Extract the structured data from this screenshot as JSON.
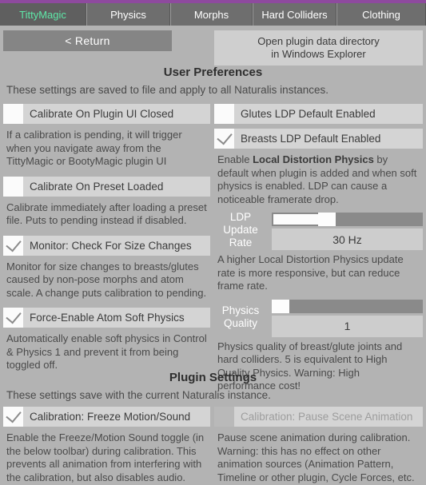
{
  "theme": {
    "accent": "#8e4a9e",
    "active_tab_text": "#5ee8a8",
    "panel_bg": "#b3b3b3",
    "toggle_bg": "#d4d4d4"
  },
  "tabs": [
    {
      "label": "TittyMagic",
      "active": true
    },
    {
      "label": "Physics",
      "active": false
    },
    {
      "label": "Morphs",
      "active": false
    },
    {
      "label": "Hard Colliders",
      "active": false
    },
    {
      "label": "Clothing",
      "active": false
    }
  ],
  "header": {
    "return_label": "<  Return",
    "open_dir_line1": "Open plugin data directory",
    "open_dir_line2": "in Windows Explorer"
  },
  "user_preferences": {
    "heading": "User Preferences",
    "subtitle": "These settings are saved to file and apply to all Naturalis instances.",
    "left": [
      {
        "label": "Calibrate On Plugin UI Closed",
        "checked": false,
        "disabled": false,
        "desc": "If a calibration is pending, it will trigger when you navigate away from the TittyMagic or BootyMagic plugin UI"
      },
      {
        "label": "Calibrate On Preset Loaded",
        "checked": false,
        "disabled": false,
        "desc": "Calibrate immediately after loading a preset file. Puts to pending instead if disabled."
      },
      {
        "label": "Monitor: Check For Size Changes",
        "checked": true,
        "disabled": false,
        "desc": "Monitor for size changes to breasts/glutes caused by non-pose morphs and atom scale. A change puts calibration to pending."
      },
      {
        "label": "Force-Enable Atom Soft Physics",
        "checked": true,
        "disabled": false,
        "desc": "Automatically enable soft physics in Control & Physics 1 and prevent it from being toggled off."
      }
    ],
    "right": {
      "toggles": [
        {
          "label": "Glutes LDP Default Enabled",
          "checked": false,
          "disabled": false
        },
        {
          "label": "Breasts LDP Default Enabled",
          "checked": true,
          "disabled": false
        }
      ],
      "ldp_desc_prefix": "Enable ",
      "ldp_desc_bold": "Local Distortion Physics",
      "ldp_desc_suffix": " by default when plugin is added and when soft physics is enabled. LDP can cause a noticeable framerate drop.",
      "sliders": [
        {
          "label": "LDP Update Rate",
          "value_text": "30 Hz",
          "fill_percent": 32,
          "desc": "A higher Local Distortion Physics update rate is more responsive, but can reduce frame rate."
        },
        {
          "label": "Physics Quality",
          "value_text": "1",
          "fill_percent": 0,
          "desc": "Physics quality of breast/glute joints and hard colliders. 5 is equivalent to High Quality Physics. Warning: High performance cost!"
        }
      ]
    }
  },
  "plugin_settings": {
    "heading": "Plugin Settings",
    "subtitle": "These settings save with the current Naturalis instance.",
    "left": {
      "label": "Calibration: Freeze Motion/Sound",
      "checked": true,
      "disabled": false,
      "desc": "Enable the Freeze/Motion Sound toggle (in the below toolbar) during calibration. This prevents all animation from interfering with the calibration, but also disables audio."
    },
    "right": {
      "label": "Calibration: Pause Scene Animation",
      "checked": false,
      "disabled": true,
      "desc": "Pause scene animation during calibration. Warning: this has no effect on other animation sources (Animation Pattern, Timeline or other plugin, Cycle Forces, etc."
    }
  }
}
